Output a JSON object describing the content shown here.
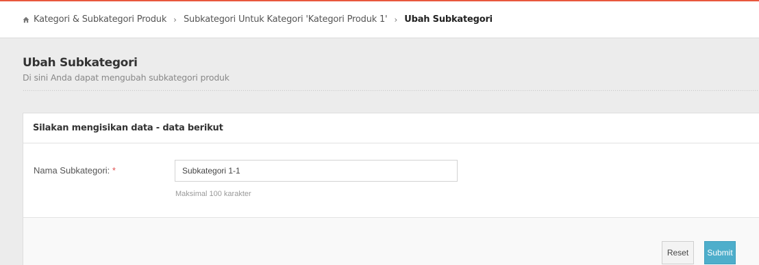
{
  "colors": {
    "accent_top": "#e8573d",
    "submit_button": "#4eaecb",
    "required_mark": "#e05050"
  },
  "breadcrumb": {
    "home_icon": "home-icon",
    "items": [
      "Kategori & Subkategori Produk",
      "Subkategori Untuk Kategori 'Kategori Produk 1'"
    ],
    "current": "Ubah Subkategori",
    "separator": "›"
  },
  "page": {
    "title": "Ubah Subkategori",
    "subtitle": "Di sini Anda dapat mengubah subkategori produk"
  },
  "panel": {
    "heading": "Silakan mengisikan data - data berikut"
  },
  "form": {
    "field_label": "Nama Subkategori:",
    "required_mark": "*",
    "field_value": "Subkategori 1-1",
    "help_text": "Maksimal 100 karakter"
  },
  "actions": {
    "reset_label": "Reset",
    "submit_label": "Submit"
  }
}
